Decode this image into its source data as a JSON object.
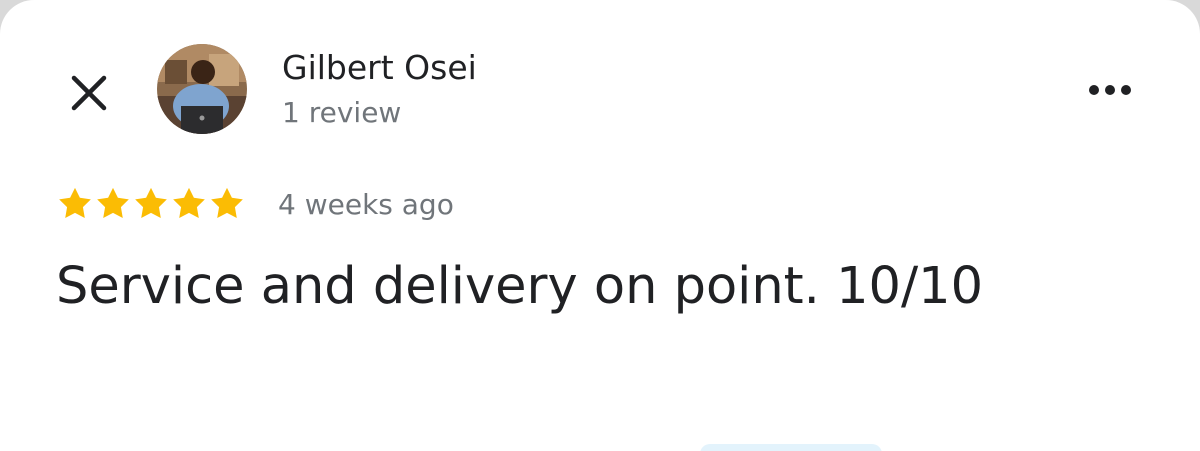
{
  "header": {
    "close_icon": "close-icon",
    "more_icon": "more-horizontal-icon"
  },
  "author": {
    "name": "Gilbert Osei",
    "review_count": "1 review",
    "avatar_icon": "avatar-photo"
  },
  "review": {
    "rating": 5,
    "rating_max": 5,
    "date": "4 weeks ago",
    "text": "Service and delivery on point. 10/10"
  },
  "colors": {
    "star": "#fbbc04",
    "primary_text": "#202124",
    "secondary_text": "#70757a",
    "hint": "#e3f3fc"
  }
}
